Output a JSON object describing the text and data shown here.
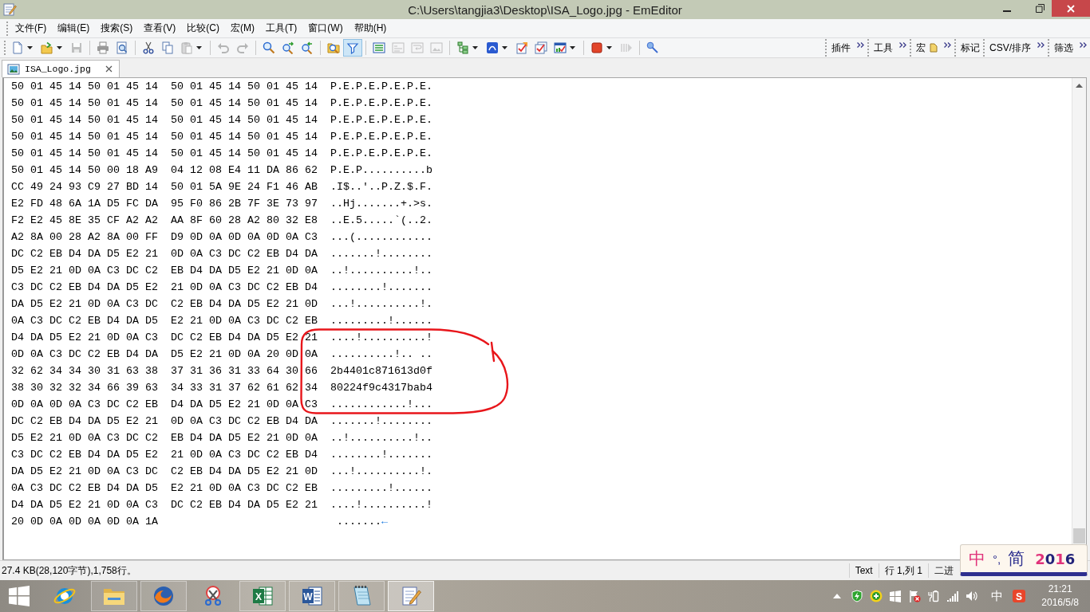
{
  "window": {
    "title": "C:\\Users\\tangjia3\\Desktop\\ISA_Logo.jpg - EmEditor"
  },
  "menu": [
    "文件(F)",
    "编辑(E)",
    "搜索(S)",
    "查看(V)",
    "比较(C)",
    "宏(M)",
    "工具(T)",
    "窗口(W)",
    "帮助(H)"
  ],
  "toolbar": {
    "groups": [
      {
        "buttons": [
          {
            "pressed": false,
            "disabled": false,
            "dropdown": true
          },
          {
            "pressed": false,
            "disabled": false,
            "dropdown": true
          },
          {
            "pressed": false,
            "disabled": true,
            "dropdown": false
          }
        ]
      },
      {
        "buttons": [
          {
            "pressed": false,
            "disabled": false,
            "dropdown": false
          },
          {
            "pressed": false,
            "disabled": false,
            "dropdown": false
          }
        ]
      },
      {
        "buttons": [
          {
            "pressed": false,
            "disabled": false,
            "dropdown": false
          },
          {
            "pressed": false,
            "disabled": false,
            "dropdown": false
          },
          {
            "pressed": false,
            "disabled": true,
            "dropdown": true
          }
        ]
      },
      {
        "buttons": [
          {
            "pressed": false,
            "disabled": true,
            "dropdown": false
          },
          {
            "pressed": false,
            "disabled": true,
            "dropdown": false
          }
        ]
      },
      {
        "buttons": [
          {
            "pressed": false,
            "disabled": false,
            "dropdown": false
          },
          {
            "pressed": false,
            "disabled": false,
            "dropdown": false
          },
          {
            "pressed": false,
            "disabled": false,
            "dropdown": false
          }
        ]
      },
      {
        "buttons": [
          {
            "pressed": false,
            "disabled": false,
            "dropdown": false
          },
          {
            "pressed": true,
            "disabled": false,
            "dropdown": false
          }
        ]
      },
      {
        "buttons": [
          {
            "pressed": false,
            "disabled": false,
            "dropdown": false
          },
          {
            "pressed": false,
            "disabled": true,
            "dropdown": false
          },
          {
            "pressed": false,
            "disabled": true,
            "dropdown": false
          },
          {
            "pressed": false,
            "disabled": true,
            "dropdown": false
          }
        ]
      },
      {
        "buttons": [
          {
            "pressed": false,
            "disabled": false,
            "dropdown": true
          },
          {
            "pressed": false,
            "disabled": false,
            "dropdown": true
          },
          {
            "pressed": false,
            "disabled": false,
            "dropdown": false
          },
          {
            "pressed": false,
            "disabled": false,
            "dropdown": false
          },
          {
            "pressed": false,
            "disabled": false,
            "dropdown": true
          }
        ]
      },
      {
        "buttons": [
          {
            "pressed": false,
            "disabled": false,
            "dropdown": true
          },
          {
            "pressed": false,
            "disabled": true,
            "dropdown": false
          }
        ]
      },
      {
        "buttons": [
          {
            "pressed": false,
            "disabled": false,
            "dropdown": false
          }
        ]
      }
    ]
  },
  "toolbar_bands": [
    {
      "label": "插件",
      "icon": false,
      "overflow": true
    },
    {
      "label": "工具",
      "icon": false,
      "overflow": true
    },
    {
      "label": "宏",
      "icon": true,
      "overflow": true
    },
    {
      "label": "标记",
      "icon": false,
      "overflow": false
    },
    {
      "label": "CSV/排序",
      "icon": false,
      "overflow": true
    },
    {
      "label": "筛选",
      "icon": false,
      "overflow": true
    }
  ],
  "tabs": [
    {
      "label": "ISA_Logo.jpg",
      "selected": true
    }
  ],
  "editor": {
    "rows": [
      {
        "hex_1": "50 01 45 14 50 01 45 14",
        "hex_2": "50 01 45 14 50 01 45 14",
        "ascii": "P.E.P.E.P.E.P.E."
      },
      {
        "hex_1": "50 01 45 14 50 01 45 14",
        "hex_2": "50 01 45 14 50 01 45 14",
        "ascii": "P.E.P.E.P.E.P.E."
      },
      {
        "hex_1": "50 01 45 14 50 01 45 14",
        "hex_2": "50 01 45 14 50 01 45 14",
        "ascii": "P.E.P.E.P.E.P.E."
      },
      {
        "hex_1": "50 01 45 14 50 01 45 14",
        "hex_2": "50 01 45 14 50 01 45 14",
        "ascii": "P.E.P.E.P.E.P.E."
      },
      {
        "hex_1": "50 01 45 14 50 01 45 14",
        "hex_2": "50 01 45 14 50 01 45 14",
        "ascii": "P.E.P.E.P.E.P.E."
      },
      {
        "hex_1": "50 01 45 14 50 00 18 A9",
        "hex_2": "04 12 08 E4 11 DA 86 62",
        "ascii": "P.E.P..........b"
      },
      {
        "hex_1": "CC 49 24 93 C9 27 BD 14",
        "hex_2": "50 01 5A 9E 24 F1 46 AB",
        "ascii": ".I$..'..P.Z.$.F."
      },
      {
        "hex_1": "E2 FD 48 6A 1A D5 FC DA",
        "hex_2": "95 F0 86 2B 7F 3E 73 97",
        "ascii": "..Hj.......+.>s."
      },
      {
        "hex_1": "F2 E2 45 8E 35 CF A2 A2",
        "hex_2": "AA 8F 60 28 A2 80 32 E8",
        "ascii": "..E.5.....`(..2."
      },
      {
        "hex_1": "A2 8A 00 28 A2 8A 00 FF",
        "hex_2": "D9 0D 0A 0D 0A 0D 0A C3",
        "ascii": "...(............"
      },
      {
        "hex_1": "DC C2 EB D4 DA D5 E2 21",
        "hex_2": "0D 0A C3 DC C2 EB D4 DA",
        "ascii": ".......!........"
      },
      {
        "hex_1": "D5 E2 21 0D 0A C3 DC C2",
        "hex_2": "EB D4 DA D5 E2 21 0D 0A",
        "ascii": "..!..........!.."
      },
      {
        "hex_1": "C3 DC C2 EB D4 DA D5 E2",
        "hex_2": "21 0D 0A C3 DC C2 EB D4",
        "ascii": "........!......."
      },
      {
        "hex_1": "DA D5 E2 21 0D 0A C3 DC",
        "hex_2": "C2 EB D4 DA D5 E2 21 0D",
        "ascii": "...!..........!."
      },
      {
        "hex_1": "0A C3 DC C2 EB D4 DA D5",
        "hex_2": "E2 21 0D 0A C3 DC C2 EB",
        "ascii": ".........!......"
      },
      {
        "hex_1": "D4 DA D5 E2 21 0D 0A C3",
        "hex_2": "DC C2 EB D4 DA D5 E2 21",
        "ascii": "....!..........!"
      },
      {
        "hex_1": "0D 0A C3 DC C2 EB D4 DA",
        "hex_2": "D5 E2 21 0D 0A 20 0D 0A",
        "ascii": "..........!.. .."
      },
      {
        "hex_1": "32 62 34 34 30 31 63 38",
        "hex_2": "37 31 36 31 33 64 30 66",
        "ascii": "2b4401c871613d0f"
      },
      {
        "hex_1": "38 30 32 32 34 66 39 63",
        "hex_2": "34 33 31 37 62 61 62 34",
        "ascii": "80224f9c4317bab4"
      },
      {
        "hex_1": "0D 0A 0D 0A C3 DC C2 EB",
        "hex_2": "D4 DA D5 E2 21 0D 0A C3",
        "ascii": "............!..."
      },
      {
        "hex_1": "DC C2 EB D4 DA D5 E2 21",
        "hex_2": "0D 0A C3 DC C2 EB D4 DA",
        "ascii": ".......!........"
      },
      {
        "hex_1": "D5 E2 21 0D 0A C3 DC C2",
        "hex_2": "EB D4 DA D5 E2 21 0D 0A",
        "ascii": "..!..........!.."
      },
      {
        "hex_1": "C3 DC C2 EB D4 DA D5 E2",
        "hex_2": "21 0D 0A C3 DC C2 EB D4",
        "ascii": "........!......."
      },
      {
        "hex_1": "DA D5 E2 21 0D 0A C3 DC",
        "hex_2": "C2 EB D4 DA D5 E2 21 0D",
        "ascii": "...!..........!."
      },
      {
        "hex_1": "0A C3 DC C2 EB D4 DA D5",
        "hex_2": "E2 21 0D 0A C3 DC C2 EB",
        "ascii": ".........!......"
      },
      {
        "hex_1": "D4 DA D5 E2 21 0D 0A C3",
        "hex_2": "DC C2 EB D4 DA D5 E2 21",
        "ascii": "....!..........!"
      },
      {
        "hex_1": "20 0D 0A 0D 0A 0D 0A 1A",
        "ascii": " .......",
        "eof_mark": "←"
      }
    ],
    "annotations": [
      {
        "kind": "freehand-ellipse"
      }
    ]
  },
  "status_bar": {
    "summary": "27.4 KB(28,120字节),1,758行。",
    "cells": [
      "Text",
      "行 1,列 1",
      "二进"
    ]
  },
  "ime_bar": {
    "mode": "中",
    "punctuation": "°,",
    "script": "简",
    "year": "2016"
  },
  "taskbar": {
    "apps": [
      {
        "running": false,
        "selected": false
      },
      {
        "running": true,
        "selected": false
      },
      {
        "running": true,
        "selected": false
      },
      {
        "running": false,
        "selected": false
      },
      {
        "running": true,
        "selected": false,
        "letter": "X"
      },
      {
        "running": true,
        "selected": false,
        "letter": "W"
      },
      {
        "running": true,
        "selected": false
      },
      {
        "running": true,
        "selected": true
      }
    ],
    "tray": {
      "language": "中",
      "ime_letter": "S",
      "time": "21:21",
      "date": "2016/5/8"
    }
  }
}
